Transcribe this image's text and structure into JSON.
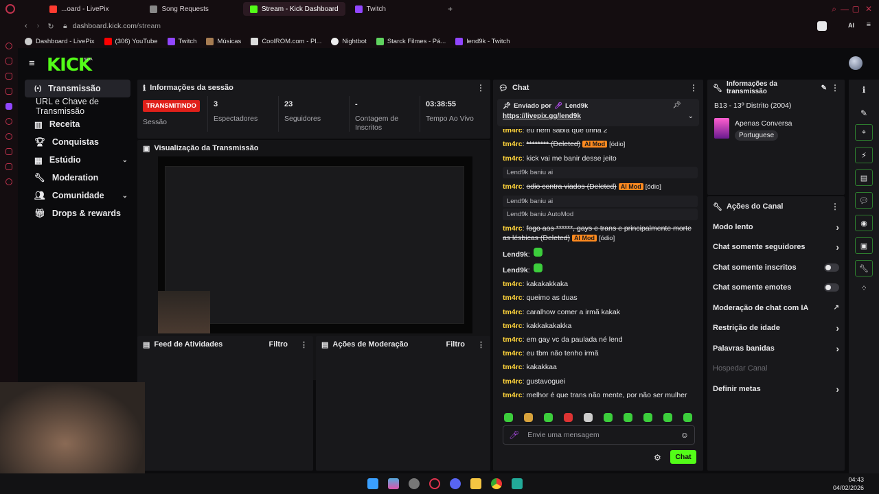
{
  "browser": {
    "tabs": [
      {
        "label": "...oard - LivePix",
        "color": "#ff3b30"
      },
      {
        "label": "Song Requests",
        "color": "#888888"
      },
      {
        "label": "Stream - Kick Dashboard",
        "color": "#53fc18"
      },
      {
        "label": "Twitch",
        "color": "#9146ff"
      }
    ],
    "address": {
      "host": "dashboard.kick.com",
      "path": "/stream"
    },
    "bookmarks": [
      "Dashboard - LivePix",
      "(306) YouTube",
      "Twitch",
      "Músicas",
      "CoolROM.com - Pl...",
      "Nightbot",
      "Starck Filmes - Pá...",
      "lend9k - Twitch"
    ],
    "ai_label": "AI"
  },
  "brand": {
    "logo": "KICK",
    "beta": "BETA",
    "accent": "#53fc18"
  },
  "sidebar": {
    "items": [
      {
        "label": "Transmissão",
        "icon": "broadcast-icon",
        "active": true
      },
      {
        "label": "URL e Chave de Transmissão",
        "sub": true
      },
      {
        "label": "Receita",
        "icon": "revenue-icon"
      },
      {
        "label": "Conquistas",
        "icon": "trophy-icon"
      },
      {
        "label": "Estúdio",
        "icon": "studio-icon",
        "expand": true
      },
      {
        "label": "Moderation",
        "icon": "wrench-icon"
      },
      {
        "label": "Comunidade",
        "icon": "people-icon",
        "expand": true
      },
      {
        "label": "Drops & rewards",
        "icon": "gift-icon"
      }
    ]
  },
  "session": {
    "title": "Informações da sessão",
    "status": "TRANSMITINDO",
    "status_label": "Sessão",
    "viewers": "3",
    "viewers_label": "Espectadores",
    "followers": "23",
    "followers_label": "Seguidores",
    "subs": "-",
    "subs_label": "Contagem de Inscritos",
    "uptime": "03:38:55",
    "uptime_label": "Tempo Ao Vivo"
  },
  "preview": {
    "title": "Visualização da Transmissão"
  },
  "activity": {
    "title": "Feed de Atividades",
    "filter": "Filtro"
  },
  "modactions": {
    "title": "Ações de Moderação",
    "filter": "Filtro"
  },
  "chat": {
    "title": "Chat",
    "pinned_by_label": "Enviado por",
    "pinned_user": "Lend9k",
    "pinned_link": "https://livepix.gg/lend9k",
    "cutoff": "eu nem sabia que tinha 2",
    "messages": [
      {
        "type": "msg",
        "user": "tm4rc",
        "text": "******** (Deleted)",
        "ai": "AI Mod",
        "tag": "[ódio]"
      },
      {
        "type": "msg",
        "user": "tm4rc",
        "text": "kick vai me banir desse jeito"
      },
      {
        "type": "sys",
        "text": "Lend9k baniu ai"
      },
      {
        "type": "msg",
        "user": "tm4rc",
        "text": "odio contra viados (Deleted)",
        "ai": "AI Mod",
        "tag": "[ódio]"
      },
      {
        "type": "sys",
        "text": "Lend9k baniu ai"
      },
      {
        "type": "sys",
        "text": "Lend9k baniu AutoMod"
      },
      {
        "type": "msg",
        "user": "tm4rc",
        "text": "fogo aos ******, gays e trans e principalmente morte as lésbicas (Deleted)",
        "ai": "AI Mod",
        "tag": "[ódio]"
      },
      {
        "type": "emote",
        "user": "Lend9k"
      },
      {
        "type": "emote",
        "user": "Lend9k"
      },
      {
        "type": "msg",
        "user": "tm4rc",
        "text": "kakakakkaka"
      },
      {
        "type": "msg",
        "user": "tm4rc",
        "text": "queimo as duas"
      },
      {
        "type": "msg",
        "user": "tm4rc",
        "text": "caralhow comer a irmã kakak"
      },
      {
        "type": "msg",
        "user": "tm4rc",
        "text": "kakkakakakka"
      },
      {
        "type": "msg",
        "user": "tm4rc",
        "text": "em gay vc da paulada né lend"
      },
      {
        "type": "msg",
        "user": "tm4rc",
        "text": "eu tbm não tenho irmã"
      },
      {
        "type": "msg",
        "user": "tm4rc",
        "text": "kakakkaa"
      },
      {
        "type": "msg",
        "user": "tm4rc",
        "text": "gustavoguei"
      },
      {
        "type": "msg",
        "user": "tm4rc",
        "text": "melhor é que trans não mente, por não ser mulher"
      }
    ],
    "input_placeholder": "Envie uma mensagem",
    "send_label": "Chat"
  },
  "stream_info": {
    "title": "Informações da transmissão",
    "stream_title": "B13 - 13º Distrito (2004)",
    "category": "Apenas Conversa",
    "language": "Portuguese"
  },
  "channel_actions": {
    "title": "Ações do Canal",
    "items": [
      {
        "label": "Modo lento",
        "control": "arrow"
      },
      {
        "label": "Chat somente seguidores",
        "control": "arrow"
      },
      {
        "label": "Chat somente inscritos",
        "control": "toggle"
      },
      {
        "label": "Chat somente emotes",
        "control": "toggle"
      },
      {
        "label": "Moderação de chat com IA",
        "control": "external"
      },
      {
        "label": "Restrição de idade",
        "control": "arrow"
      },
      {
        "label": "Palavras banidas",
        "control": "arrow"
      },
      {
        "label": "Hospedar Canal",
        "control": "disabled"
      },
      {
        "label": "Definir metas",
        "control": "arrow"
      }
    ]
  },
  "taskbar": {
    "time": "04:43",
    "date": "04/02/2026"
  }
}
